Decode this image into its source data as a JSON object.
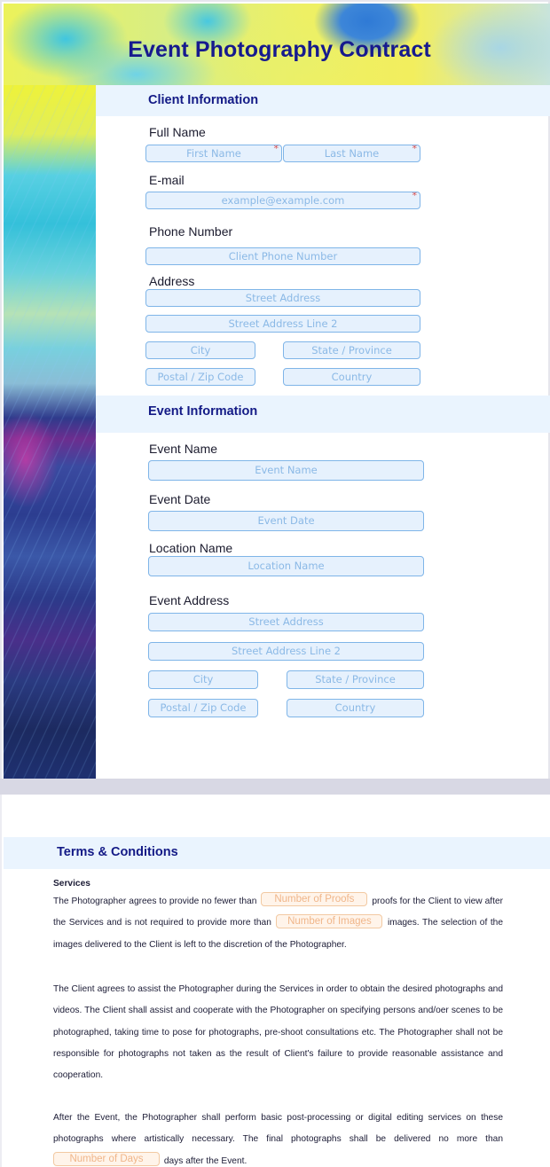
{
  "header": {
    "title": "Event Photography Contract"
  },
  "client_section": {
    "title": "Client Information",
    "full_name": {
      "label": "Full Name",
      "first_placeholder": "First Name",
      "last_placeholder": "Last Name",
      "required_mark": "*"
    },
    "email": {
      "label": "E-mail",
      "placeholder": "example@example.com",
      "required_mark": "*"
    },
    "phone": {
      "label": "Phone Number",
      "placeholder": "Client Phone Number"
    },
    "address": {
      "label": "Address",
      "street": "Street Address",
      "street2": "Street Address Line 2",
      "city": "City",
      "state": "State / Province",
      "postal": "Postal / Zip Code",
      "country": "Country"
    }
  },
  "event_section": {
    "title": "Event Information",
    "event_name": {
      "label": "Event Name",
      "placeholder": "Event Name"
    },
    "event_date": {
      "label": "Event Date",
      "placeholder": "Event Date"
    },
    "location_name": {
      "label": "Location Name",
      "placeholder": "Location Name"
    },
    "event_address": {
      "label": "Event Address",
      "street": "Street Address",
      "street2": "Street Address Line 2",
      "city": "City",
      "state": "State / Province",
      "postal": "Postal / Zip Code",
      "country": "Country"
    }
  },
  "terms": {
    "title": "Terms & Conditions",
    "services_heading": "Services",
    "p1": {
      "t1": "The Photographer agrees to provide no fewer than",
      "proofs_placeholder": "Number of Proofs",
      "t2": "proofs for the Client to view after the Services and is not required to provide more than",
      "images_placeholder": "Number of Images",
      "t3": "images. The selection of the images delivered to the Client is left to the discretion of the Photographer."
    },
    "p2": "The Client agrees to assist the Photographer during the Services in order to obtain the desired photographs and videos. The Client shall assist and cooperate with the Photographer on specifying persons and/oer scenes to be photographed, taking time to pose for photographs, pre-shoot consultations etc. The Photographer shall not be responsible for photographs not taken as the result of Client's failure to provide reasonable assistance and cooperation.",
    "p3": {
      "t1": "After the Event, the Photographer shall perform basic post-processing or digital editing services on these photographs where artistically necessary. The final photographs shall be delivered no more than",
      "days_placeholder": "Number of Days",
      "t2": "days after the Event."
    }
  },
  "colors": {
    "title": "#161a8e",
    "section_band": "#eaf4fe",
    "field_bg": "#e6f1fd",
    "field_border": "#7fb5e8",
    "placeholder": "#8bb9e6",
    "required": "#d84a4a",
    "inline_field_border": "#f2c9a2",
    "inline_field_text": "#f0b68a"
  }
}
